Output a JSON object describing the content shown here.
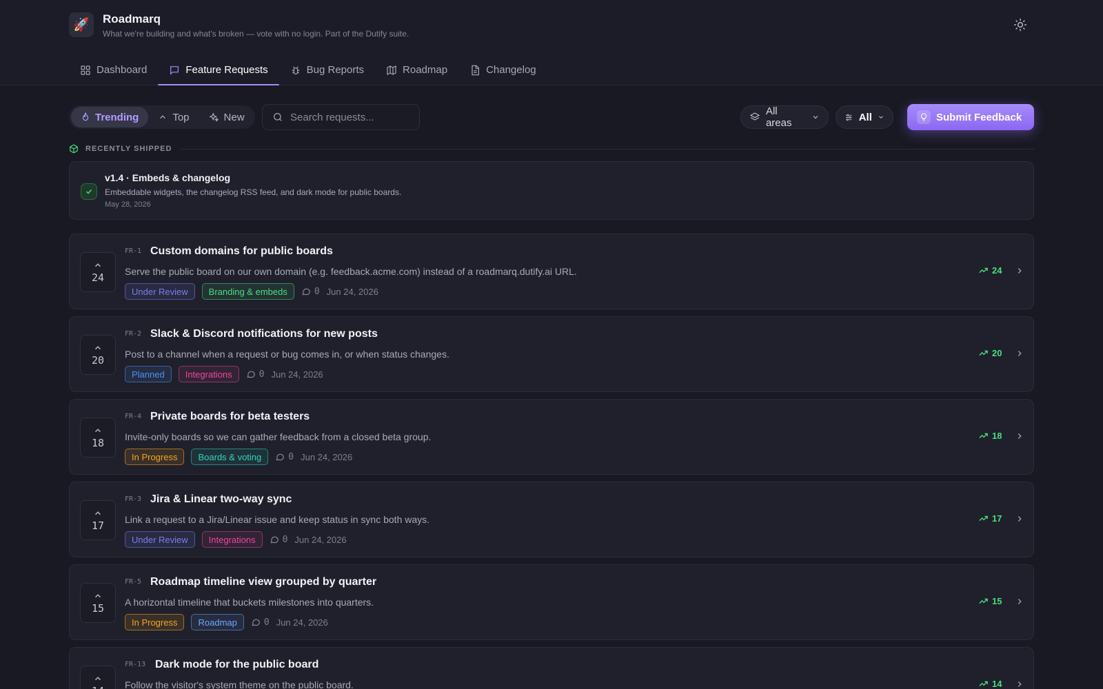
{
  "app": {
    "name": "Roadmarq",
    "tagline": "What we're building and what's broken — vote with no login. Part of the Dutify suite.",
    "logo_icon": "rocket-icon"
  },
  "nav": {
    "tabs": [
      {
        "label": "Dashboard",
        "icon": "grid-icon",
        "active": false
      },
      {
        "label": "Feature Requests",
        "icon": "message-square-icon",
        "active": true
      },
      {
        "label": "Bug Reports",
        "icon": "bug-icon",
        "active": false
      },
      {
        "label": "Roadmap",
        "icon": "map-icon",
        "active": false
      },
      {
        "label": "Changelog",
        "icon": "file-text-icon",
        "active": false
      }
    ]
  },
  "toolbar": {
    "sort": [
      {
        "label": "Trending",
        "icon": "flame-icon",
        "active": true
      },
      {
        "label": "Top",
        "icon": "chevron-up-icon",
        "active": false
      },
      {
        "label": "New",
        "icon": "sparkles-icon",
        "active": false
      }
    ],
    "search_placeholder": "Search requests...",
    "area_filter": "All areas",
    "status_filter": "All",
    "submit_label": "Submit Feedback"
  },
  "shipped": {
    "heading": "RECENTLY SHIPPED",
    "title": "v1.4 · Embeds & changelog",
    "description": "Embeddable widgets, the changelog RSS feed, and dark mode for public boards.",
    "date": "May 28, 2026"
  },
  "requests": [
    {
      "id": "FR-1",
      "title": "Custom domains for public boards",
      "description": "Serve the public board on our own domain (e.g. feedback.acme.com) instead of a roadmarq.dutify.ai URL.",
      "votes": "24",
      "status": "Under Review",
      "area": "Branding & embeds",
      "comments": "0",
      "date": "Jun 24, 2026",
      "trend": "24"
    },
    {
      "id": "FR-2",
      "title": "Slack & Discord notifications for new posts",
      "description": "Post to a channel when a request or bug comes in, or when status changes.",
      "votes": "20",
      "status": "Planned",
      "area": "Integrations",
      "comments": "0",
      "date": "Jun 24, 2026",
      "trend": "20"
    },
    {
      "id": "FR-4",
      "title": "Private boards for beta testers",
      "description": "Invite-only boards so we can gather feedback from a closed beta group.",
      "votes": "18",
      "status": "In Progress",
      "area": "Boards & voting",
      "comments": "0",
      "date": "Jun 24, 2026",
      "trend": "18"
    },
    {
      "id": "FR-3",
      "title": "Jira & Linear two-way sync",
      "description": "Link a request to a Jira/Linear issue and keep status in sync both ways.",
      "votes": "17",
      "status": "Under Review",
      "area": "Integrations",
      "comments": "0",
      "date": "Jun 24, 2026",
      "trend": "17"
    },
    {
      "id": "FR-5",
      "title": "Roadmap timeline view grouped by quarter",
      "description": "A horizontal timeline that buckets milestones into quarters.",
      "votes": "15",
      "status": "In Progress",
      "area": "Roadmap",
      "comments": "0",
      "date": "Jun 24, 2026",
      "trend": "15"
    },
    {
      "id": "FR-13",
      "title": "Dark mode for the public board",
      "description": "Follow the visitor's system theme on the public board.",
      "votes": "14",
      "status": "",
      "area": "",
      "comments": "",
      "date": "",
      "trend": "14"
    }
  ],
  "colors": {
    "accent": "#a78bfa",
    "trend_green": "#4ade80",
    "status_under_review": "#7c7cf0",
    "status_planned": "#4f8ff5",
    "status_in_progress": "#f5a524",
    "area_branding": "#4ade80",
    "area_integrations": "#ec4899",
    "area_boards": "#2dd4bf",
    "area_roadmap": "#6fa8ff"
  }
}
